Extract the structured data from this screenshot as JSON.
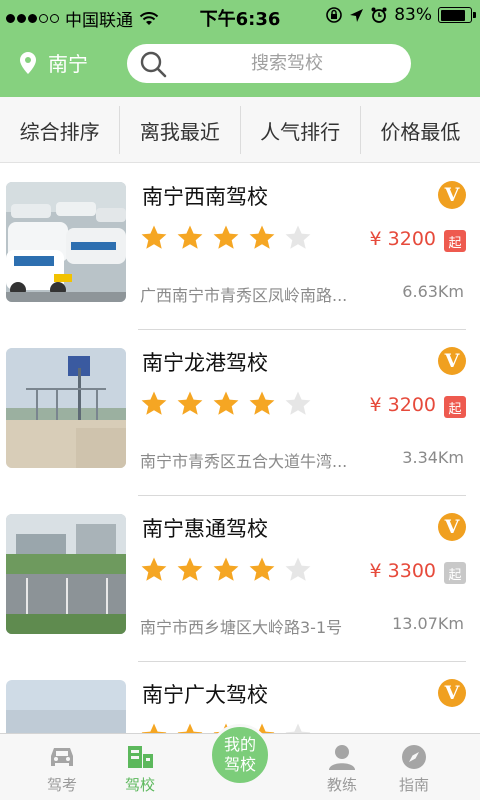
{
  "status": {
    "carrier": "中国联通",
    "time": "下午6:36",
    "battery": "83%",
    "battery_level": 0.83
  },
  "header": {
    "city": "南宁",
    "search_placeholder": "搜索驾校"
  },
  "tabs": [
    {
      "label": "综合排序"
    },
    {
      "label": "离我最近"
    },
    {
      "label": "人气排行"
    },
    {
      "label": "价格最低"
    }
  ],
  "schools": [
    {
      "name": "南宁西南驾校",
      "badge": "V",
      "rating": 4,
      "price": "¥ 3200",
      "qi": "起",
      "address": "广西南宁市青秀区凤岭南路...",
      "distance": "6.63Km"
    },
    {
      "name": "南宁龙港驾校",
      "badge": "V",
      "rating": 4,
      "price": "¥ 3200",
      "qi": "起",
      "address": "南宁市青秀区五合大道牛湾...",
      "distance": "3.34Km"
    },
    {
      "name": "南宁惠通驾校",
      "badge": "V",
      "rating": 4,
      "price": "¥ 3300",
      "qi": "起",
      "address": "南宁市西乡塘区大岭路3-1号",
      "distance": "13.07Km"
    },
    {
      "name": "南宁广大驾校",
      "badge": "V",
      "rating": 4,
      "price": "",
      "qi": "",
      "address": "",
      "distance": ""
    }
  ],
  "nav": {
    "exam": "驾考",
    "school": "驾校",
    "mine": "我的\n驾校",
    "coach": "教练",
    "guide": "指南"
  },
  "colors": {
    "accent": "#86d17f",
    "price": "#e64a3b",
    "star": "#f5a623",
    "badge": "#f0a020"
  }
}
